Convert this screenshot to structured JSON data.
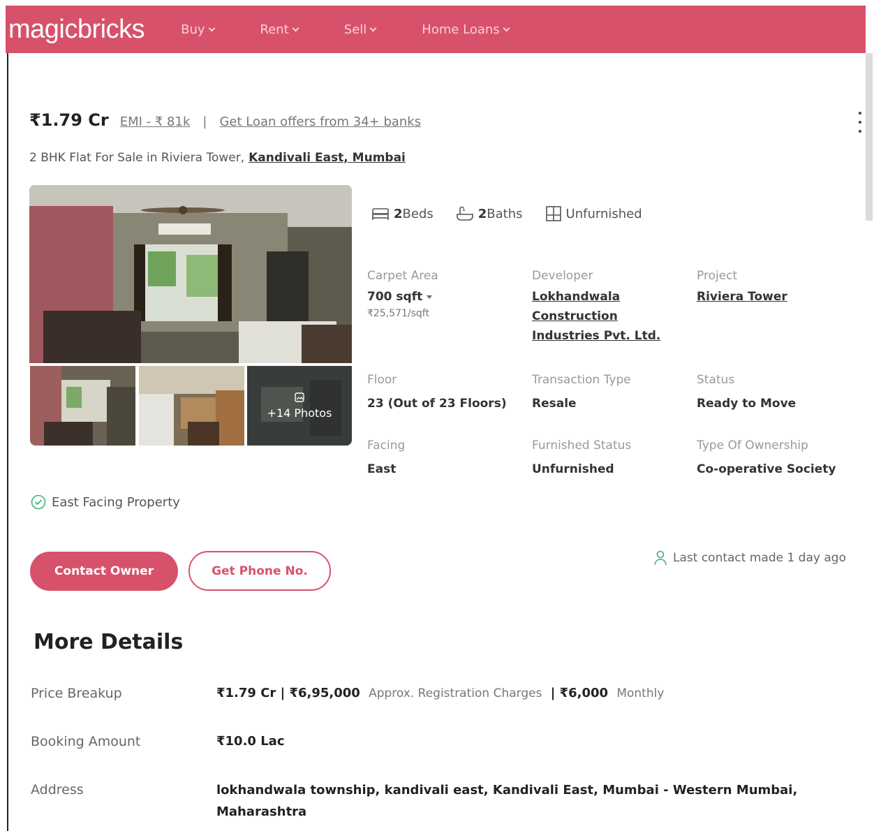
{
  "nav": {
    "logo": "magicbricks",
    "items": [
      {
        "label": "Buy"
      },
      {
        "label": "Rent"
      },
      {
        "label": "Sell"
      },
      {
        "label": "Home Loans"
      }
    ]
  },
  "listing": {
    "price": "₹1.79 Cr",
    "emi": "EMI - ₹ 81k",
    "separator": "|",
    "loan_offer": "Get Loan offers from 34+ banks",
    "subtitle": "2 BHK Flat For Sale in Riviera Tower,",
    "locality": "Kandivali East, Mumbai",
    "photos_label": "+14 Photos"
  },
  "amenities": [
    {
      "count": "2",
      "label": "Beds",
      "icon": "bed-icon"
    },
    {
      "count": "2",
      "label": "Baths",
      "icon": "bath-icon"
    },
    {
      "count": "",
      "label": "Unfurnished",
      "icon": "furnishing-icon"
    }
  ],
  "details": {
    "carpet_area": {
      "label": "Carpet Area",
      "value": "700 sqft",
      "sub": "₹25,571/sqft"
    },
    "developer": {
      "label": "Developer",
      "value": "Lokhandwala Construction Industries Pvt. Ltd."
    },
    "project": {
      "label": "Project",
      "value": "Riviera Tower"
    },
    "floor": {
      "label": "Floor",
      "value": "23 (Out of 23 Floors)"
    },
    "transaction": {
      "label": "Transaction Type",
      "value": "Resale"
    },
    "status": {
      "label": "Status",
      "value": "Ready to Move"
    },
    "facing": {
      "label": "Facing",
      "value": "East"
    },
    "furnished": {
      "label": "Furnished Status",
      "value": "Unfurnished"
    },
    "ownership": {
      "label": "Type Of Ownership",
      "value": "Co-operative Society"
    }
  },
  "feature": "East Facing Property",
  "actions": {
    "contact_owner": "Contact Owner",
    "get_phone": "Get Phone No.",
    "last_contact": "Last contact made 1 day ago"
  },
  "more_details": {
    "title": "More Details",
    "price_breakup": {
      "label": "Price Breakup",
      "price": "₹1.79 Cr",
      "sep1": "|",
      "registration": "₹6,95,000",
      "registration_note": "Approx. Registration Charges",
      "sep2": "|",
      "maintenance": "₹6,000",
      "maintenance_note": "Monthly"
    },
    "booking": {
      "label": "Booking Amount",
      "value": "₹10.0 Lac"
    },
    "address": {
      "label": "Address",
      "value": "lokhandwala township, kandivali east, Kandivali East, Mumbai - Western Mumbai, Maharashtra"
    }
  },
  "colors": {
    "brand": "#d8516b",
    "success": "#3db37a"
  }
}
